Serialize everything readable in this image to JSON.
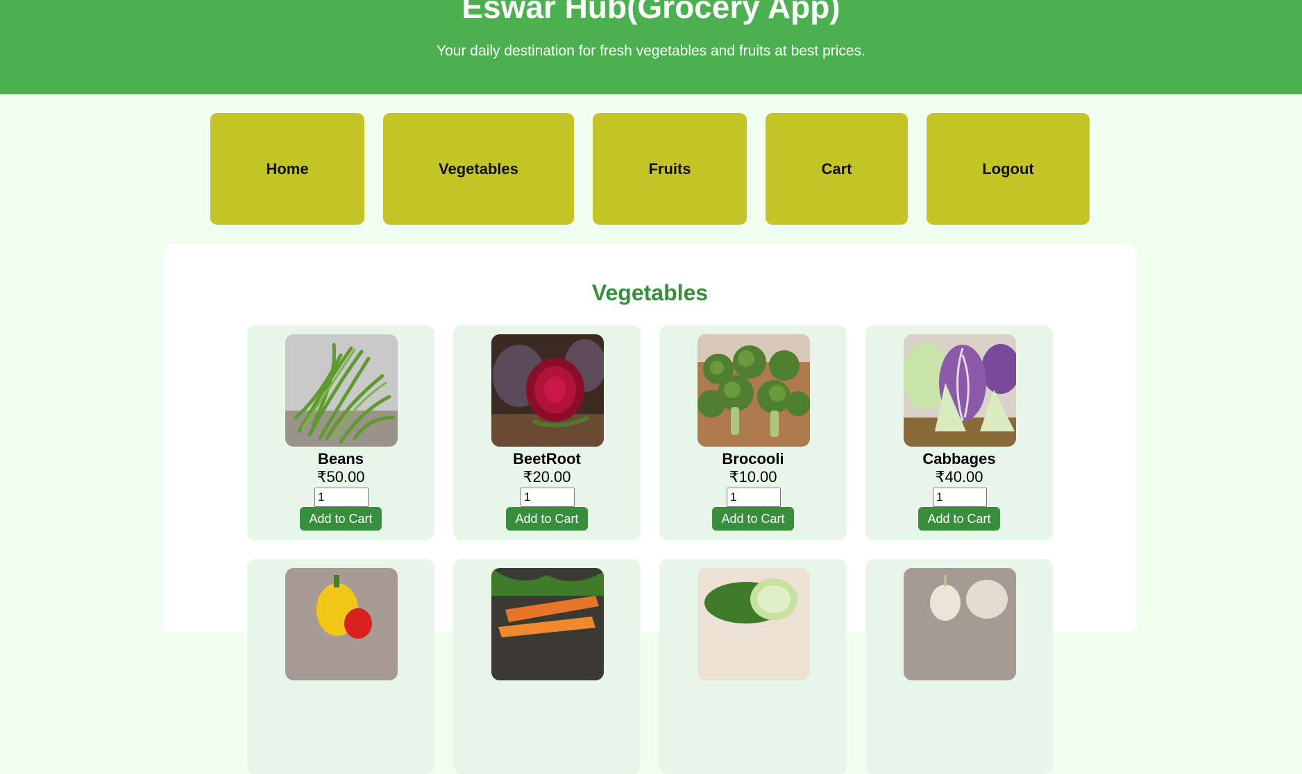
{
  "header": {
    "title": "Eswar Hub(Grocery App)",
    "subtitle": "Your daily destination for fresh vegetables and fruits at best prices."
  },
  "nav": {
    "items": [
      {
        "label": "Home"
      },
      {
        "label": "Vegetables"
      },
      {
        "label": "Fruits"
      },
      {
        "label": "Cart"
      },
      {
        "label": "Logout"
      }
    ]
  },
  "section": {
    "title": "Vegetables",
    "add_label": "Add to Cart",
    "products": [
      {
        "name": "Beans",
        "price": "₹50.00",
        "qty": "1",
        "image": "green-beans-photo"
      },
      {
        "name": "BeetRoot",
        "price": "₹20.00",
        "qty": "1",
        "image": "beetroot-photo"
      },
      {
        "name": "Brocooli",
        "price": "₹10.00",
        "qty": "1",
        "image": "broccoli-photo"
      },
      {
        "name": "Cabbages",
        "price": "₹40.00",
        "qty": "1",
        "image": "cabbage-photo"
      }
    ],
    "next_row_images": [
      "bell-pepper-photo",
      "carrot-photo",
      "cucumber-photo",
      "garlic-photo"
    ]
  },
  "colors": {
    "header_bg": "#4caf50",
    "page_bg": "#f0fff0",
    "nav_button": "#c5c426",
    "accent": "#388e3c",
    "card_bg": "#e8f5e9"
  }
}
